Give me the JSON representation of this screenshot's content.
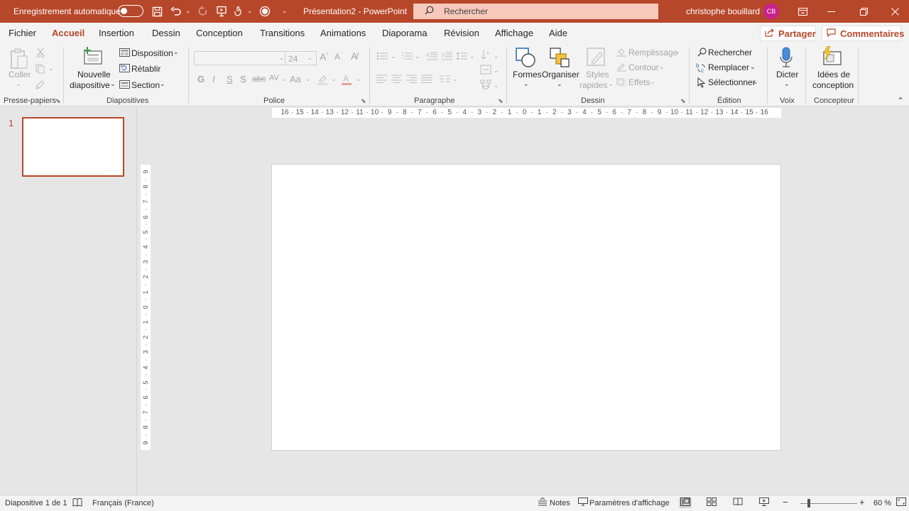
{
  "titlebar": {
    "autosave_label": "Enregistrement automatique",
    "title": "Présentation2  -  PowerPoint",
    "search_placeholder": "Rechercher",
    "user_name": "christophe bouillard",
    "user_initials": "CB"
  },
  "tabs": [
    "Fichier",
    "Accueil",
    "Insertion",
    "Dessin",
    "Conception",
    "Transitions",
    "Animations",
    "Diaporama",
    "Révision",
    "Affichage",
    "Aide"
  ],
  "active_tab": "Accueil",
  "share_label": "Partager",
  "comments_label": "Commentaires",
  "ribbon": {
    "clipboard": {
      "paste": "Coller",
      "label": "Presse-papiers"
    },
    "slides": {
      "new_slide_1": "Nouvelle",
      "new_slide_2": "diapositive",
      "layout": "Disposition",
      "reset": "Rétablir",
      "section": "Section",
      "label": "Diapositives"
    },
    "font": {
      "size": "24",
      "bold": "G",
      "italic": "I",
      "underline": "S",
      "strike": "S",
      "spacing": "AV",
      "case": "Aa",
      "label": "Police"
    },
    "paragraph": {
      "label": "Paragraphe"
    },
    "drawing": {
      "shapes": "Formes",
      "arrange": "Organiser",
      "quick_styles_1": "Styles",
      "quick_styles_2": "rapides",
      "fill": "Remplissage",
      "outline": "Contour",
      "effects": "Effets",
      "label": "Dessin"
    },
    "editing": {
      "find": "Rechercher",
      "replace": "Remplacer",
      "select": "Sélectionner",
      "label": "Édition"
    },
    "voice": {
      "dictate": "Dicter",
      "label": "Voix"
    },
    "designer": {
      "ideas_1": "Idées de",
      "ideas_2": "conception",
      "label": "Concepteur"
    }
  },
  "thumbnail": {
    "number": "1"
  },
  "hruler_marks": [
    "16",
    "15",
    "14",
    "13",
    "12",
    "11",
    "10",
    "9",
    "8",
    "7",
    "6",
    "5",
    "4",
    "3",
    "2",
    "1",
    "0",
    "1",
    "2",
    "3",
    "4",
    "5",
    "6",
    "7",
    "8",
    "9",
    "10",
    "11",
    "12",
    "13",
    "14",
    "15",
    "16"
  ],
  "vruler_marks": [
    "9",
    "8",
    "7",
    "6",
    "5",
    "4",
    "3",
    "2",
    "1",
    "0",
    "1",
    "2",
    "3",
    "4",
    "5",
    "6",
    "7",
    "8",
    "9"
  ],
  "status": {
    "slide_info": "Diapositive 1 de 1",
    "language": "Français (France)",
    "notes": "Notes",
    "display_settings": "Paramètres d'affichage",
    "zoom": "60 %"
  },
  "colors": {
    "accent": "#b7472a",
    "avatar": "#c9208f"
  }
}
